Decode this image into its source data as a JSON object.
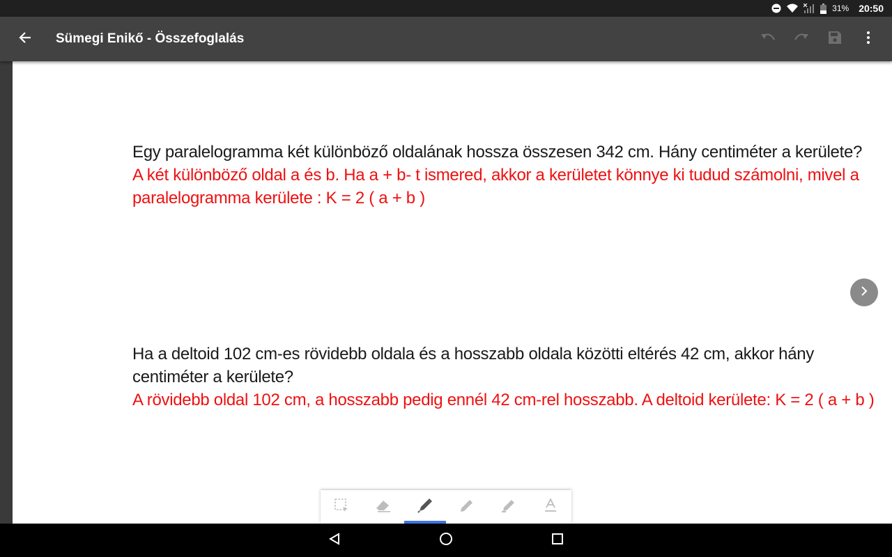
{
  "status_bar": {
    "battery": "31%",
    "time": "20:50",
    "icons": [
      "do-not-disturb-icon",
      "wifi-icon",
      "signal-icon",
      "battery-icon"
    ]
  },
  "app_bar": {
    "title": "Sümegi Enikő - Összefoglalás",
    "icons": [
      "back-arrow-icon",
      "undo-icon",
      "redo-icon",
      "save-icon",
      "more-vert-icon"
    ]
  },
  "document": {
    "tasks": [
      {
        "question": "Egy paralelogramma két különböző oldalának hossza összesen 342 cm. Hány centiméter a kerülete?",
        "answer": "A két különböző oldal a és b. Ha a + b- t ismered, akkor a kerületet könnye ki tudud számolni, mivel a paralelogramma kerülete : K = 2 ( a + b )"
      },
      {
        "question": "Ha a deltoid 102 cm-es rövidebb oldala és a hosszabb oldala közötti eltérés 42 cm, akkor hány centiméter a kerülete?",
        "answer": "A rövidebb oldal 102 cm, a hosszabb pedig ennél 42 cm-rel hosszabb. A deltoid kerülete: K = 2 ( a + b )"
      }
    ]
  },
  "toolbar": {
    "tools": [
      "selection-icon",
      "eraser-icon",
      "pen-icon",
      "pencil-icon",
      "highlighter-icon",
      "text-icon"
    ],
    "active_tool": "pen-icon",
    "accent_color": "#3f74e0"
  },
  "colors": {
    "question_text": "#1a1a1a",
    "answer_text": "#ee1111",
    "app_bar": "#424242"
  },
  "nav_bar": {
    "icons": [
      "nav-back-icon",
      "nav-home-icon",
      "nav-recents-icon"
    ]
  }
}
